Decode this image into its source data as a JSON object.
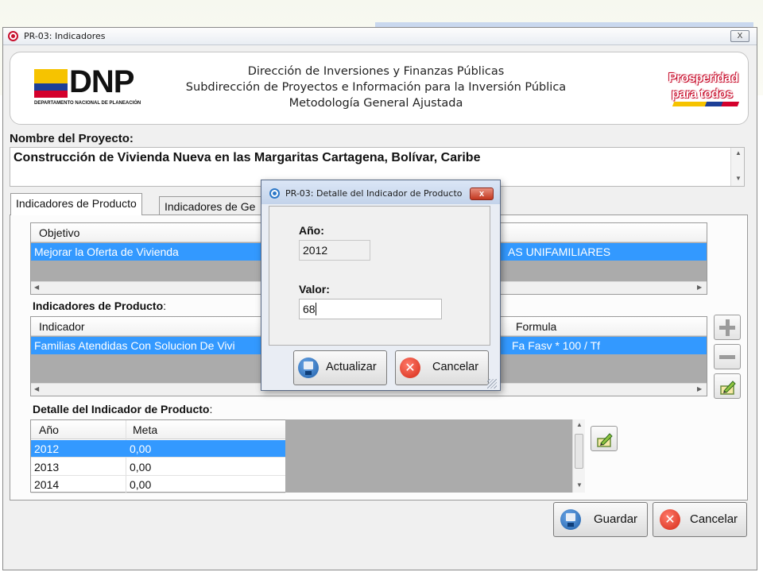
{
  "window": {
    "title": "PR-03: Indicadores",
    "close_label": "X"
  },
  "header": {
    "logo_text": "DNP",
    "logo_subtitle": "DEPARTAMENTO NACIONAL DE PLANEACIÓN",
    "lines": [
      "Dirección de Inversiones y Finanzas Públicas",
      "Subdirección de Proyectos e Información para la Inversión Pública",
      "Metodología General Ajustada"
    ],
    "brand_line1": "Prosperidad",
    "brand_line2": "para todos"
  },
  "project": {
    "label": "Nombre del Proyecto:",
    "value": "Construcción de Vivienda Nueva en las Margaritas Cartagena, Bolívar, Caribe"
  },
  "tabs": [
    {
      "label": "Indicadores de Producto",
      "selected": true
    },
    {
      "label": "Indicadores de Ge",
      "selected": false
    }
  ],
  "objetivo_grid": {
    "header": "Objetivo",
    "selected_row_left": "Mejorar la Oferta de Vivienda",
    "selected_row_right": "AS UNIFAMILIARES"
  },
  "indicadores": {
    "label": "Indicadores de Producto",
    "colon": ":",
    "col_indicador": "Indicador",
    "col_formula": "Formula",
    "row_indicador": "Familias Atendidas Con Solucion De Vivi",
    "row_formula": "Fa  Fasv * 100 / Tf"
  },
  "detalle": {
    "label": "Detalle del Indicador de Producto",
    "colon": ":",
    "col_anio": "Año",
    "col_meta": "Meta",
    "rows": [
      {
        "anio": "2012",
        "meta": "0,00",
        "selected": true
      },
      {
        "anio": "2013",
        "meta": "0,00",
        "selected": false
      },
      {
        "anio": "2014",
        "meta": "0,00",
        "selected": false
      }
    ]
  },
  "buttons": {
    "guardar": "Guardar",
    "cancelar": "Cancelar"
  },
  "dialog": {
    "title": "PR-03: Detalle del Indicador de Producto",
    "close_label": "x",
    "anio_label": "Año:",
    "anio_value": "2012",
    "valor_label": "Valor:",
    "valor_value": "68",
    "actualizar": "Actualizar",
    "cancelar": "Cancelar"
  },
  "colors": {
    "selection": "#3399ff",
    "grid_empty": "#ababab",
    "brand_red": "#c8102e",
    "flag_yellow": "#f6c300",
    "flag_blue": "#1d3f97"
  },
  "icons": [
    "app-icon",
    "close-icon",
    "plus-icon",
    "minus-icon",
    "edit-icon",
    "save-icon",
    "cancel-icon"
  ]
}
